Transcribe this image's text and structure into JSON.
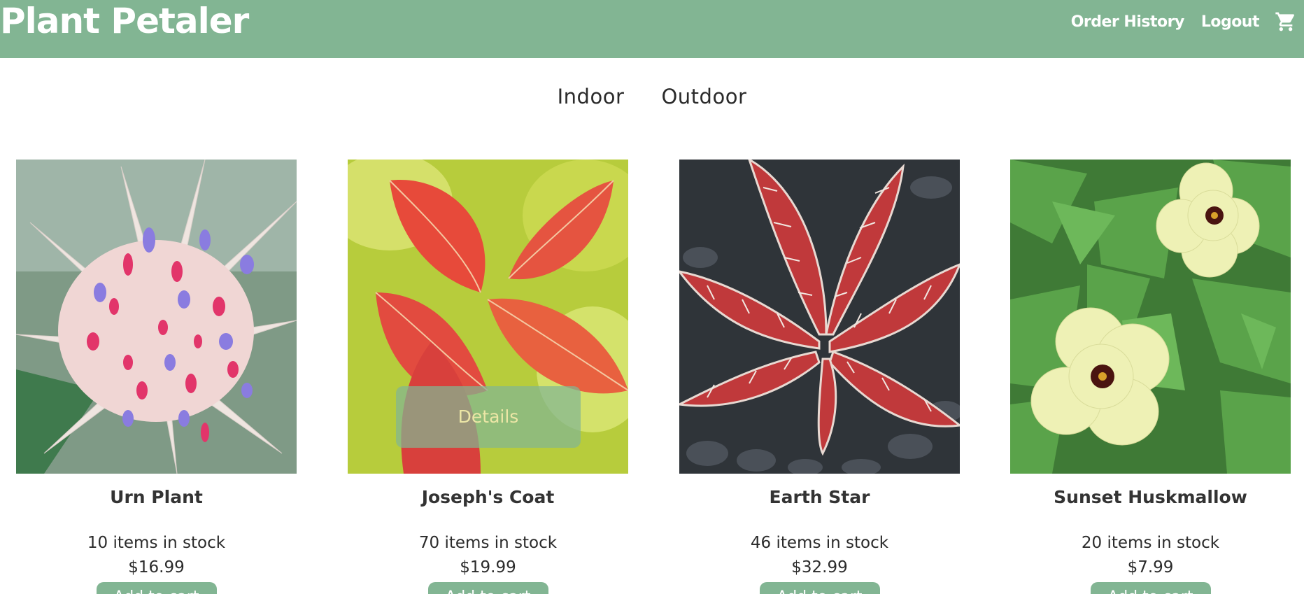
{
  "header": {
    "brand": "Plant Petaler",
    "order_history": "Order History",
    "logout": "Logout",
    "cart_icon": "shopping-cart-icon"
  },
  "categories": [
    "Indoor",
    "Outdoor"
  ],
  "details_label": "Details",
  "add_to_cart_label": "Add to cart",
  "products": [
    {
      "name": "Urn Plant",
      "stock": "10 items in stock",
      "price": "$16.99"
    },
    {
      "name": "Joseph's Coat",
      "stock": "70 items in stock",
      "price": "$19.99"
    },
    {
      "name": "Earth Star",
      "stock": "46 items in stock",
      "price": "$32.99"
    },
    {
      "name": "Sunset Huskmallow",
      "stock": "20 items in stock",
      "price": "$7.99"
    }
  ],
  "colors": {
    "brand_green": "#82b593",
    "white": "#ffffff",
    "text": "#2b2b2b"
  }
}
